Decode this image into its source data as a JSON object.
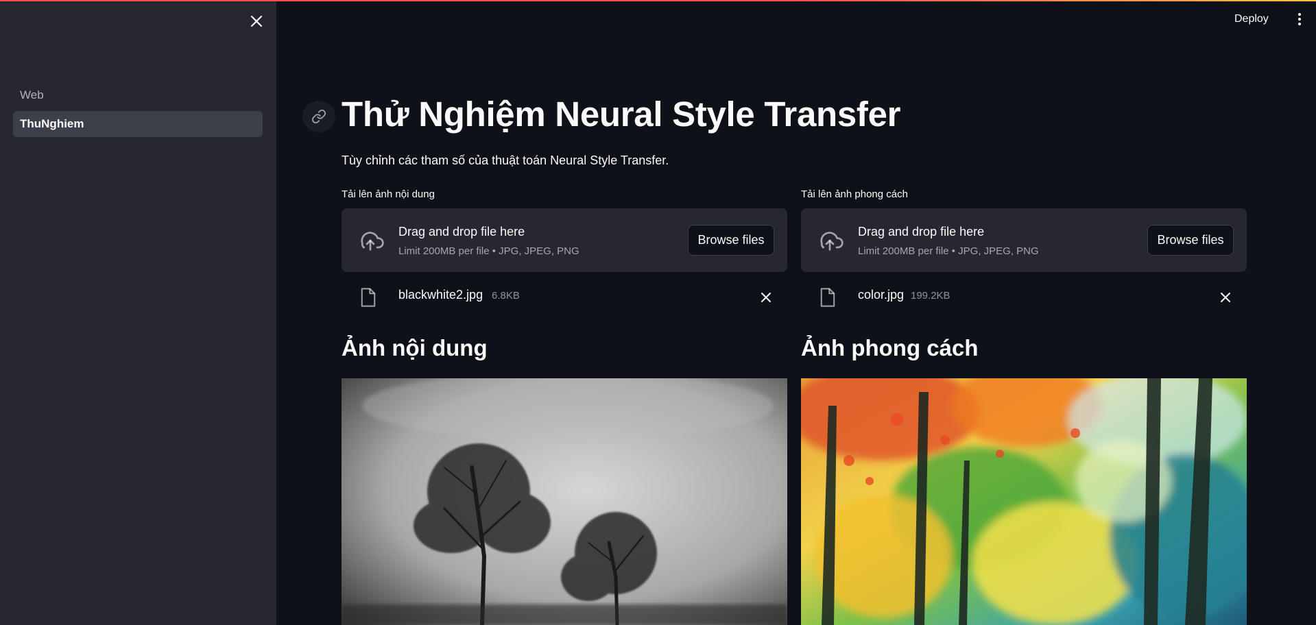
{
  "sidebar": {
    "items": [
      {
        "label": "Web",
        "active": false
      },
      {
        "label": "ThuNghiem",
        "active": true
      }
    ]
  },
  "header": {
    "deploy_label": "Deploy"
  },
  "main": {
    "title": "Thử Nghiệm Neural Style Transfer",
    "subtitle": "Tùy chỉnh các tham số của thuật toán Neural Style Transfer.",
    "uploaders": [
      {
        "label": "Tải lên ảnh nội dung",
        "drop_text": "Drag and drop file here",
        "limit_text": "Limit 200MB per file • JPG, JPEG, PNG",
        "browse_label": "Browse files",
        "file_name": "blackwhite2.jpg",
        "file_size": "6.8KB"
      },
      {
        "label": "Tải lên ảnh phong cách",
        "drop_text": "Drag and drop file here",
        "limit_text": "Limit 200MB per file • JPG, JPEG, PNG",
        "browse_label": "Browse files",
        "file_name": "color.jpg",
        "file_size": "199.2KB"
      }
    ],
    "content_heading": "Ảnh nội dung",
    "style_heading": "Ảnh phong cách"
  },
  "colors": {
    "background": "#0e1117",
    "sidebar": "#262730",
    "accent": "#ff4b4b"
  },
  "icons": [
    "close-icon",
    "kebab-menu-icon",
    "link-icon",
    "cloud-upload-icon",
    "file-icon"
  ]
}
